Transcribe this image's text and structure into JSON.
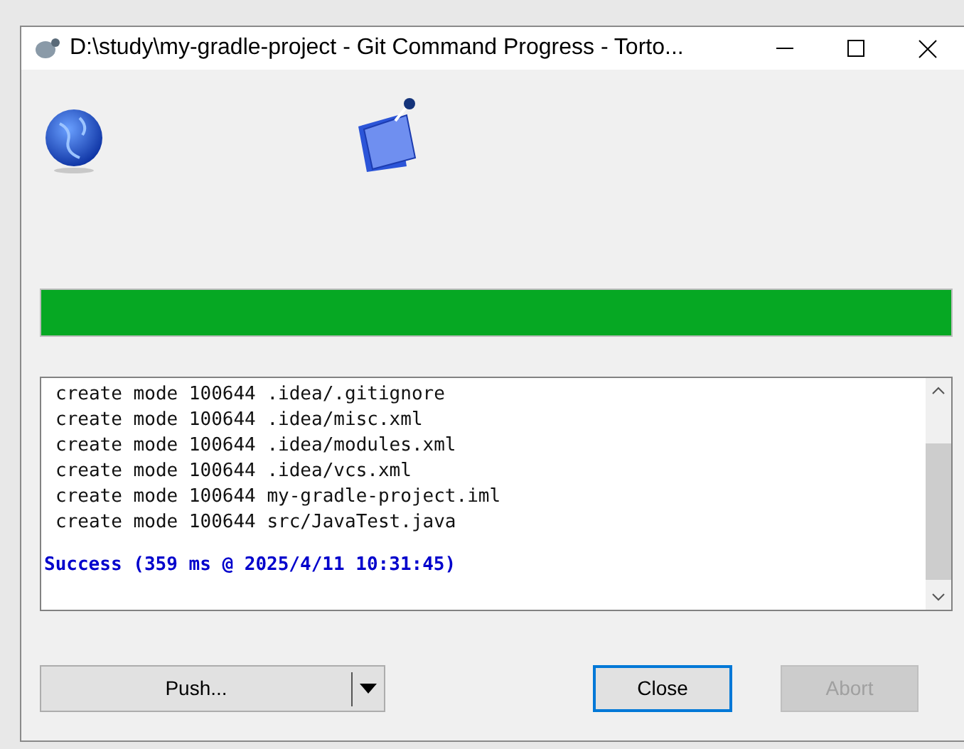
{
  "window": {
    "title": "D:\\study\\my-gradle-project - Git Command Progress - Torto..."
  },
  "progress": {
    "level": 1
  },
  "log": [
    {
      "kind": "line",
      "text": "create mode 100644 .idea/.gitignore"
    },
    {
      "kind": "line",
      "text": "create mode 100644 .idea/misc.xml"
    },
    {
      "kind": "line",
      "text": "create mode 100644 .idea/modules.xml"
    },
    {
      "kind": "line",
      "text": "create mode 100644 .idea/vcs.xml"
    },
    {
      "kind": "line",
      "text": "create mode 100644 my-gradle-project.iml"
    },
    {
      "kind": "line",
      "text": "create mode 100644 src/JavaTest.java"
    },
    {
      "kind": "blank"
    },
    {
      "kind": "success",
      "text": "Success (359 ms @ 2025/4/11 10:31:45)"
    }
  ],
  "buttons": {
    "push": {
      "label": "Push..."
    },
    "close": {
      "label": "Close",
      "focused": true
    },
    "abort": {
      "label": "Abort",
      "disabled": true
    }
  }
}
